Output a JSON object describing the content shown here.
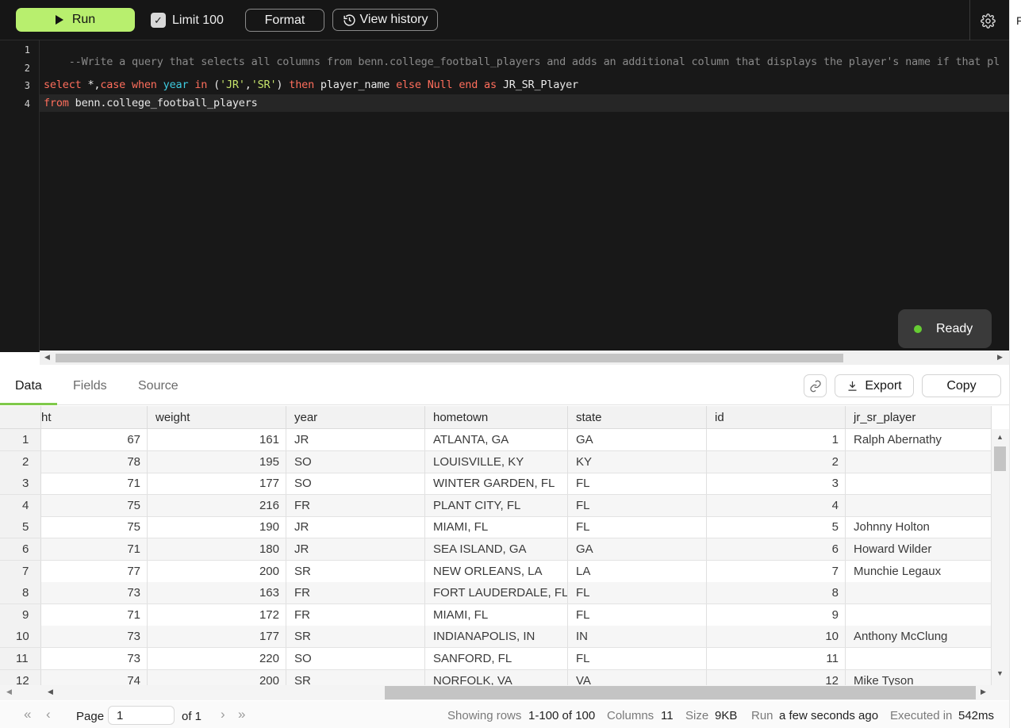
{
  "toolbar": {
    "run_label": "Run",
    "limit_label": "Limit 100",
    "limit_checked": true,
    "format_label": "Format",
    "history_label": "View history",
    "settings_icon": "gear-icon"
  },
  "right_strip": {
    "letter": "F"
  },
  "editor": {
    "line_numbers": [
      "1",
      "2",
      "3",
      "4"
    ],
    "line1_comment": "--Write a query that selects all columns from benn.college_football_players and adds an additional column that displays the player's name if that pl",
    "line3": {
      "t1": "select",
      "t2": " *,",
      "t3": "case when",
      "t4": " ",
      "t5": "year",
      "t6": " ",
      "t7": "in",
      "t8": " (",
      "t9": "'JR'",
      "t10": ",",
      "t11": "'SR'",
      "t12": ") ",
      "t13": "then",
      "t14": " player_name ",
      "t15": "else Null end as",
      "t16": " JR_SR_Player"
    },
    "line4": {
      "t1": "from",
      "t2": " benn.college_football_players"
    },
    "status": "Ready",
    "status_color": "#66cc33"
  },
  "results_tabs": [
    "Data",
    "Fields",
    "Source"
  ],
  "results_actions": {
    "export_label": "Export",
    "copy_label": "Copy",
    "link_icon": "link-icon"
  },
  "table": {
    "columns": [
      "ht",
      "weight",
      "year",
      "hometown",
      "state",
      "id",
      "jr_sr_player"
    ],
    "rows": [
      [
        "1",
        "67",
        "161",
        "JR",
        "ATLANTA, GA",
        "GA",
        "1",
        "Ralph Abernathy"
      ],
      [
        "2",
        "78",
        "195",
        "SO",
        "LOUISVILLE, KY",
        "KY",
        "2",
        ""
      ],
      [
        "3",
        "71",
        "177",
        "SO",
        "WINTER GARDEN, FL",
        "FL",
        "3",
        ""
      ],
      [
        "4",
        "75",
        "216",
        "FR",
        "PLANT CITY, FL",
        "FL",
        "4",
        ""
      ],
      [
        "5",
        "75",
        "190",
        "JR",
        "MIAMI, FL",
        "FL",
        "5",
        "Johnny Holton"
      ],
      [
        "6",
        "71",
        "180",
        "JR",
        "SEA ISLAND, GA",
        "GA",
        "6",
        "Howard Wilder"
      ],
      [
        "7",
        "77",
        "200",
        "SR",
        "NEW ORLEANS, LA",
        "LA",
        "7",
        "Munchie Legaux"
      ],
      [
        "8",
        "73",
        "163",
        "FR",
        "FORT LAUDERDALE, FL",
        "FL",
        "8",
        ""
      ],
      [
        "9",
        "71",
        "172",
        "FR",
        "MIAMI, FL",
        "FL",
        "9",
        ""
      ],
      [
        "10",
        "73",
        "177",
        "SR",
        "INDIANAPOLIS, IN",
        "IN",
        "10",
        "Anthony McClung"
      ],
      [
        "11",
        "73",
        "220",
        "SO",
        "SANFORD, FL",
        "FL",
        "11",
        ""
      ],
      [
        "12",
        "74",
        "200",
        "SR",
        "NORFOLK, VA",
        "VA",
        "12",
        "Mike Tyson"
      ]
    ]
  },
  "footer": {
    "page_label": "Page",
    "page_value": "1",
    "of_label": "of 1",
    "showing_label": "Showing rows",
    "showing_value": "1-100 of 100",
    "columns_label": "Columns",
    "columns_value": "11",
    "size_label": "Size",
    "size_value": "9KB",
    "run_label": "Run",
    "run_value": "a few seconds ago",
    "executed_label": "Executed in",
    "executed_value": "542ms"
  }
}
